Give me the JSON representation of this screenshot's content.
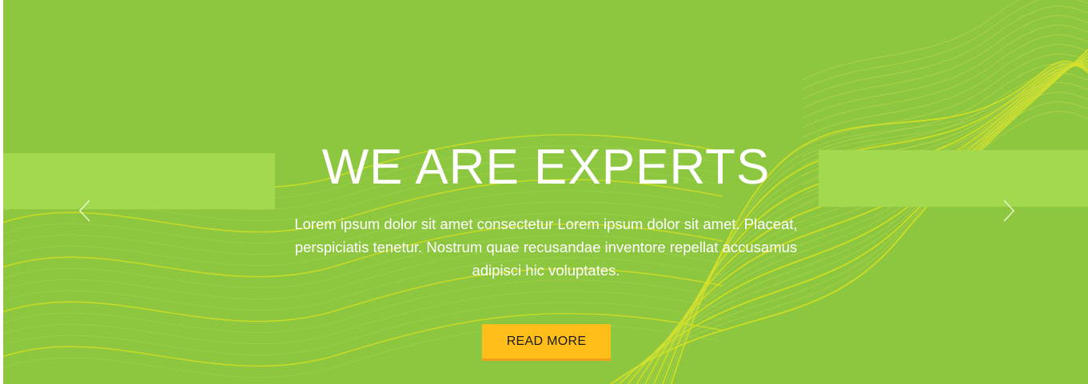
{
  "hero": {
    "title": "WE ARE EXPERTS",
    "description": "Lorem ipsum dolor sit amet consectetur Lorem ipsum dolor sit amet. Placeat, perspiciatis tenetur. Nostrum quae recusandae inventore repellat accusamus adipisci hic voluptates.",
    "button_label": "READ MORE"
  },
  "colors": {
    "background": "#8dc63f",
    "band": "#a2d94e",
    "wave_lines": "#d8e21f",
    "button": "#ffbe1a",
    "button_border": "#f59f1c"
  },
  "icons": {
    "prev": "chevron-left-icon",
    "next": "chevron-right-icon"
  }
}
